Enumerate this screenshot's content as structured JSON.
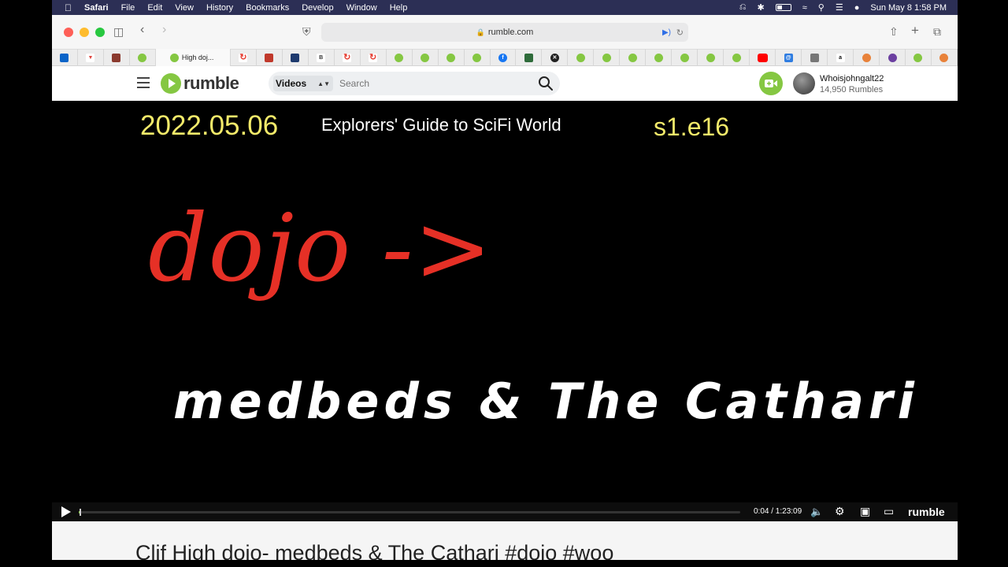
{
  "menubar": {
    "app": "Safari",
    "items": [
      "File",
      "Edit",
      "View",
      "History",
      "Bookmarks",
      "Develop",
      "Window",
      "Help"
    ],
    "datetime": "Sun May 8  1:58 PM"
  },
  "browser": {
    "url": "rumble.com",
    "active_tab": "High doj...",
    "favicons": [
      "outlook",
      "vivaldi",
      "app",
      "rumble",
      "active",
      "refresh",
      "news",
      "times",
      "bot",
      "refresh",
      "refresh",
      "rumble",
      "rumble",
      "rumble",
      "rumble",
      "facebook",
      "app",
      "xbox",
      "rumble",
      "rumble",
      "rumble",
      "rumble",
      "rumble",
      "rumble",
      "rumble",
      "youtube",
      "mail",
      "calculator",
      "amazon",
      "app",
      "app",
      "rumble",
      "app"
    ]
  },
  "rumble": {
    "logo_text": "rumble",
    "search_category": "Videos",
    "search_placeholder": "Search",
    "user_name": "Whoisjohngalt22",
    "user_rumbles": "14,950 Rumbles"
  },
  "video": {
    "date": "2022.05.06",
    "series": "Explorers' Guide to SciFi World",
    "episode": "s1.e16",
    "headline": "dojo ->",
    "subtitle": "medbeds & The Cathari",
    "time": "0:04 / 1:23:09",
    "progress": 0.001,
    "brand": "rumble"
  },
  "page": {
    "title": "Clif High dojo- medbeds & The Cathari #dojo #woo"
  },
  "colors": {
    "accent": "#85c742",
    "headline": "#e63026",
    "yellow_text": "#f3ea6a"
  }
}
